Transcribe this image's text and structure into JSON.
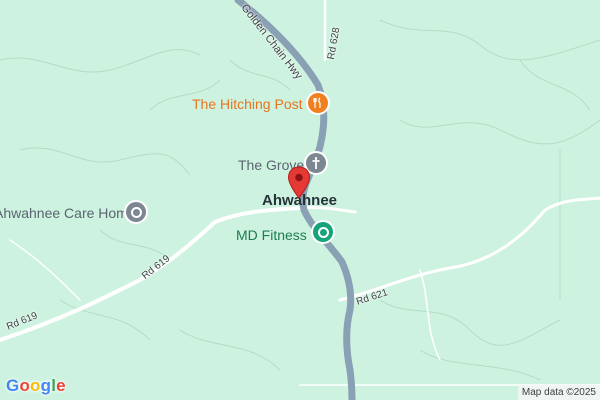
{
  "map": {
    "town": "Ahwahnee",
    "roads": {
      "highway": "Golden Chain Hwy",
      "rd628": "Rd 628",
      "rd619a": "Rd 619",
      "rd619b": "Rd 619",
      "rd621": "Rd 621"
    },
    "places": {
      "hitching_post": "The Hitching Post",
      "grove": "The Grove",
      "care_home": "Ahwahnee Care Home",
      "fitness": "MD Fitness"
    },
    "icons": {
      "hitching_post": "restaurant-icon",
      "grove": "church-icon",
      "care_home": "place-icon",
      "fitness": "fitness-icon",
      "marker": "location-pin-icon"
    },
    "colors": {
      "land": "#cdf3e0",
      "highway": "#8aa0b4",
      "minor_road": "#ffffff",
      "marker": "#e53935",
      "poi_orange": "#e8741e",
      "poi_gray": "#7c8791",
      "poi_green": "#17a37a"
    }
  },
  "branding": {
    "logo": "Google",
    "attribution": "Map data ©2025"
  }
}
